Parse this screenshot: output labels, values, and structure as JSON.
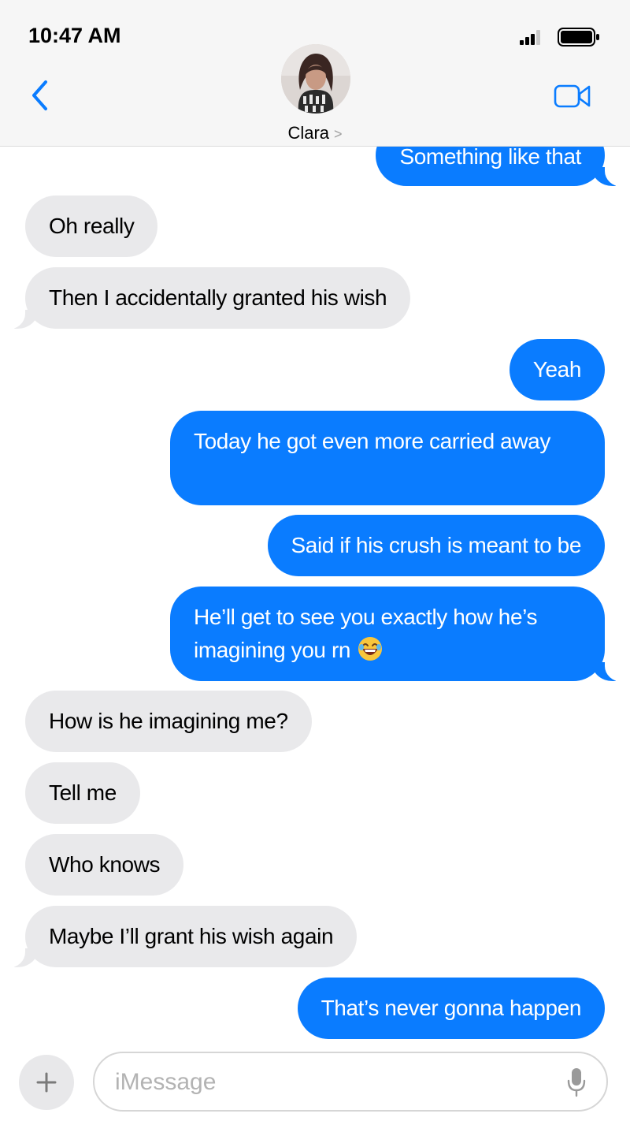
{
  "status_bar": {
    "time": "10:47 AM",
    "signal_icon": "cellular-signal-icon",
    "battery_icon": "battery-icon"
  },
  "header": {
    "back_icon": "chevron-left-icon",
    "contact_name": "Clara",
    "contact_chevron": ">",
    "video_icon": "video-camera-icon",
    "accent_color": "#0a7cff"
  },
  "messages": [
    {
      "from": "me",
      "text": "Something like that"
    },
    {
      "from": "them",
      "text": "Oh really"
    },
    {
      "from": "them",
      "text": "Then I accidentally granted his wish"
    },
    {
      "from": "me",
      "text": "Yeah"
    },
    {
      "from": "me",
      "text": "Today he got even more carried away"
    },
    {
      "from": "me",
      "text": "Said if his crush is meant to be"
    },
    {
      "from": "me",
      "text": "He’ll get to see you exactly how he’s imagining you rn",
      "emoji": "rolling-on-floor-laughing-emoji"
    },
    {
      "from": "them",
      "text": "How is he imagining me?"
    },
    {
      "from": "them",
      "text": "Tell me"
    },
    {
      "from": "them",
      "text": "Who knows"
    },
    {
      "from": "them",
      "text": "Maybe I’ll grant his wish again"
    },
    {
      "from": "me",
      "text": "That’s never gonna happen"
    }
  ],
  "colors": {
    "outgoing_bubble": "#0a7cff",
    "incoming_bubble": "#e9e9eb"
  },
  "composer": {
    "plus_icon": "plus-icon",
    "placeholder": "iMessage",
    "mic_icon": "microphone-icon"
  }
}
